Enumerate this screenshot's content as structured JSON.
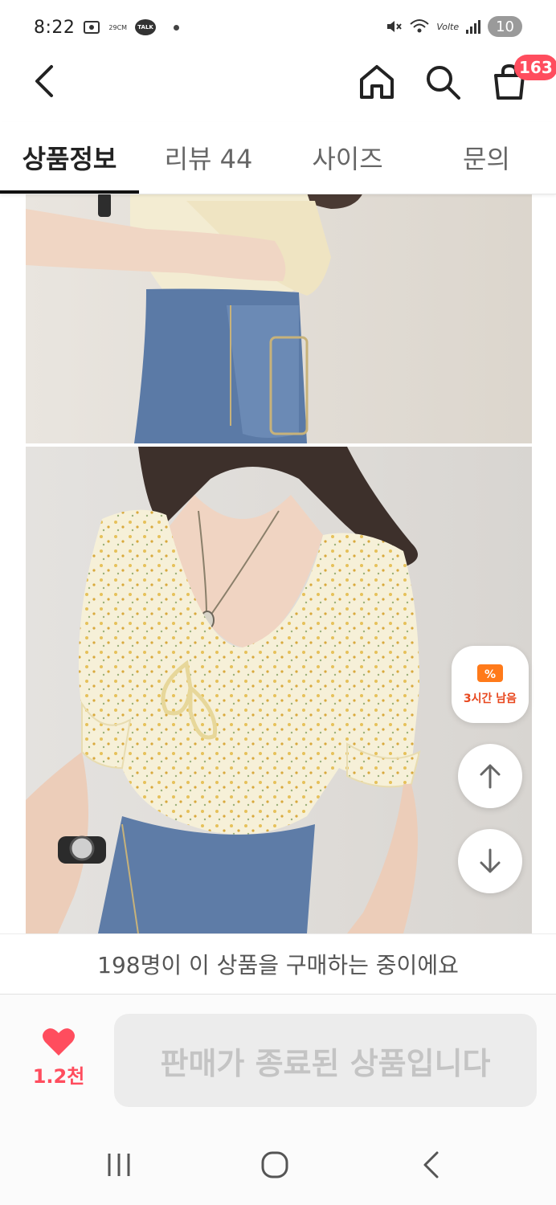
{
  "status_bar": {
    "time": "8:22",
    "temperature": "29CM",
    "talk": "TALK",
    "volte": "Volte",
    "battery": "10"
  },
  "header": {
    "cart_count": "163",
    "icons": [
      "back-chevron-icon",
      "home-icon",
      "search-icon",
      "shopping-bag-icon"
    ]
  },
  "tabs": [
    {
      "label": "상품정보",
      "active": true
    },
    {
      "label": "리뷰 44",
      "active": false
    },
    {
      "label": "사이즈",
      "active": false
    },
    {
      "label": "문의",
      "active": false
    }
  ],
  "floating": {
    "timer_label": "3시간 남음",
    "timer_color": "#e8481f"
  },
  "buyers_banner": "198명이 이 상품을 구매하는 중이에요",
  "bottom": {
    "like_count": "1.2천",
    "sold_out_label": "판매가 종료된 상품입니다",
    "accent": "#ff4d5e"
  }
}
